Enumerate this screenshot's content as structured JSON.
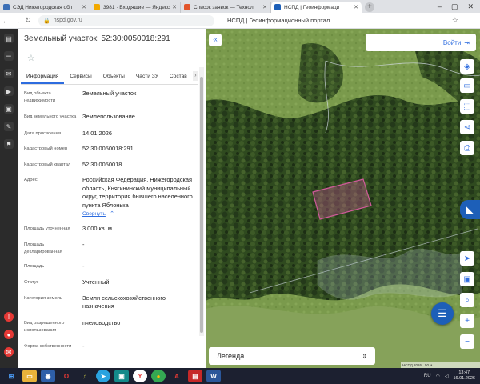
{
  "browser": {
    "tabs": [
      {
        "title": "СЭД Нижегородская обл",
        "color": "#3b6fb6",
        "active": false
      },
      {
        "title": "3981 · Входящие — Яндекс",
        "color": "#f2a900",
        "active": false
      },
      {
        "title": "Список заявок — Технол",
        "color": "#e2552b",
        "active": false
      },
      {
        "title": "НСПД | Геоинформаци",
        "color": "#1d5fb8",
        "active": true
      }
    ],
    "new_tab": "+",
    "url": "nspd.gov.ru",
    "page_title": "НСПД | Геоинформационный портал"
  },
  "panel": {
    "title": "Земельный участок: 52:30:0050018:291",
    "tabs": [
      "Информация",
      "Сервисы",
      "Объекты",
      "Части ЗУ",
      "Состав"
    ],
    "attributes": [
      {
        "label": "Вид объекта недвижимости",
        "value": "Земельный участок"
      },
      {
        "label": "Вид земельного участка",
        "value": "Землепользование"
      },
      {
        "label": "Дата присвоения",
        "value": "14.01.2026"
      },
      {
        "label": "Кадастровый номер",
        "value": "52:30:0050018:291"
      },
      {
        "label": "Кадастровый квартал",
        "value": "52:30:0050018"
      },
      {
        "label": "Адрес",
        "value": "Российская Федерация, Нижегородская область, Княгининский муниципальный округ, территория бывшего населенного пункта Яблонька"
      },
      {
        "label": "Площадь уточненная",
        "value": "3 000 кв. м"
      },
      {
        "label": "Площадь декларированная",
        "value": "-"
      },
      {
        "label": "Площадь",
        "value": "-"
      },
      {
        "label": "Статус",
        "value": "Учтенный"
      },
      {
        "label": "Категория земель",
        "value": "Земли сельскохозяйственного назначения"
      },
      {
        "label": "Вид разрешенного использования",
        "value": "пчеловодство"
      },
      {
        "label": "Форма собственности",
        "value": "-"
      }
    ],
    "collapse_link": "Свернуть"
  },
  "map": {
    "login_label": "Войти",
    "legend_label": "Легенда",
    "attribution": "НСПД 2026",
    "scale": "50 м"
  },
  "taskbar": {
    "lang": "RU",
    "time": "13:47",
    "date": "16.01.2026"
  },
  "colors": {
    "accent": "#2d6cdf",
    "brand": "#1d5fb8",
    "parcel": "#d05a9a"
  }
}
